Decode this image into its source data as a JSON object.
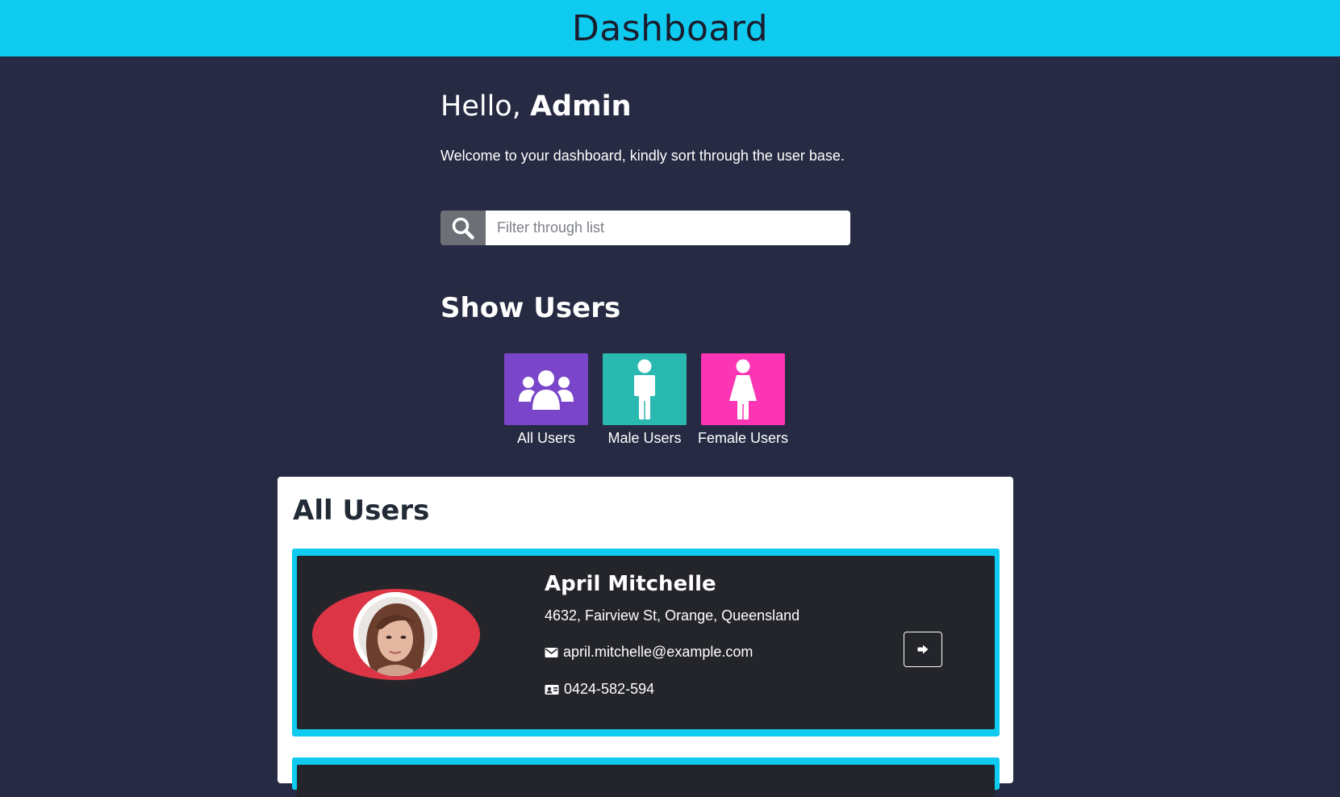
{
  "header": {
    "title": "Dashboard"
  },
  "greeting": {
    "prefix": "Hello, ",
    "name": "Admin"
  },
  "welcome_text": "Welcome to your dashboard, kindly sort through the user base.",
  "search": {
    "placeholder": "Filter through list",
    "value": "",
    "icon": "search-icon"
  },
  "show_users": {
    "title": "Show Users",
    "filters": [
      {
        "label": "All Users",
        "icon": "users-group-icon",
        "color": "#7a45c9"
      },
      {
        "label": "Male Users",
        "icon": "male-icon",
        "color": "#2ab9b0"
      },
      {
        "label": "Female Users",
        "icon": "female-icon",
        "color": "#fb35b4"
      }
    ]
  },
  "list": {
    "title": "All Users",
    "users": [
      {
        "name": "April Mitchelle",
        "address": "4632, Fairview St, Orange, Queensland",
        "email": "april.mitchelle@example.com",
        "phone": "0424-582-594"
      }
    ]
  },
  "colors": {
    "topbar": "#0fcbef",
    "background": "#262a42",
    "card_border": "#0fcbef",
    "card_bg": "#23252b",
    "avatar_oval": "#dc3545"
  }
}
